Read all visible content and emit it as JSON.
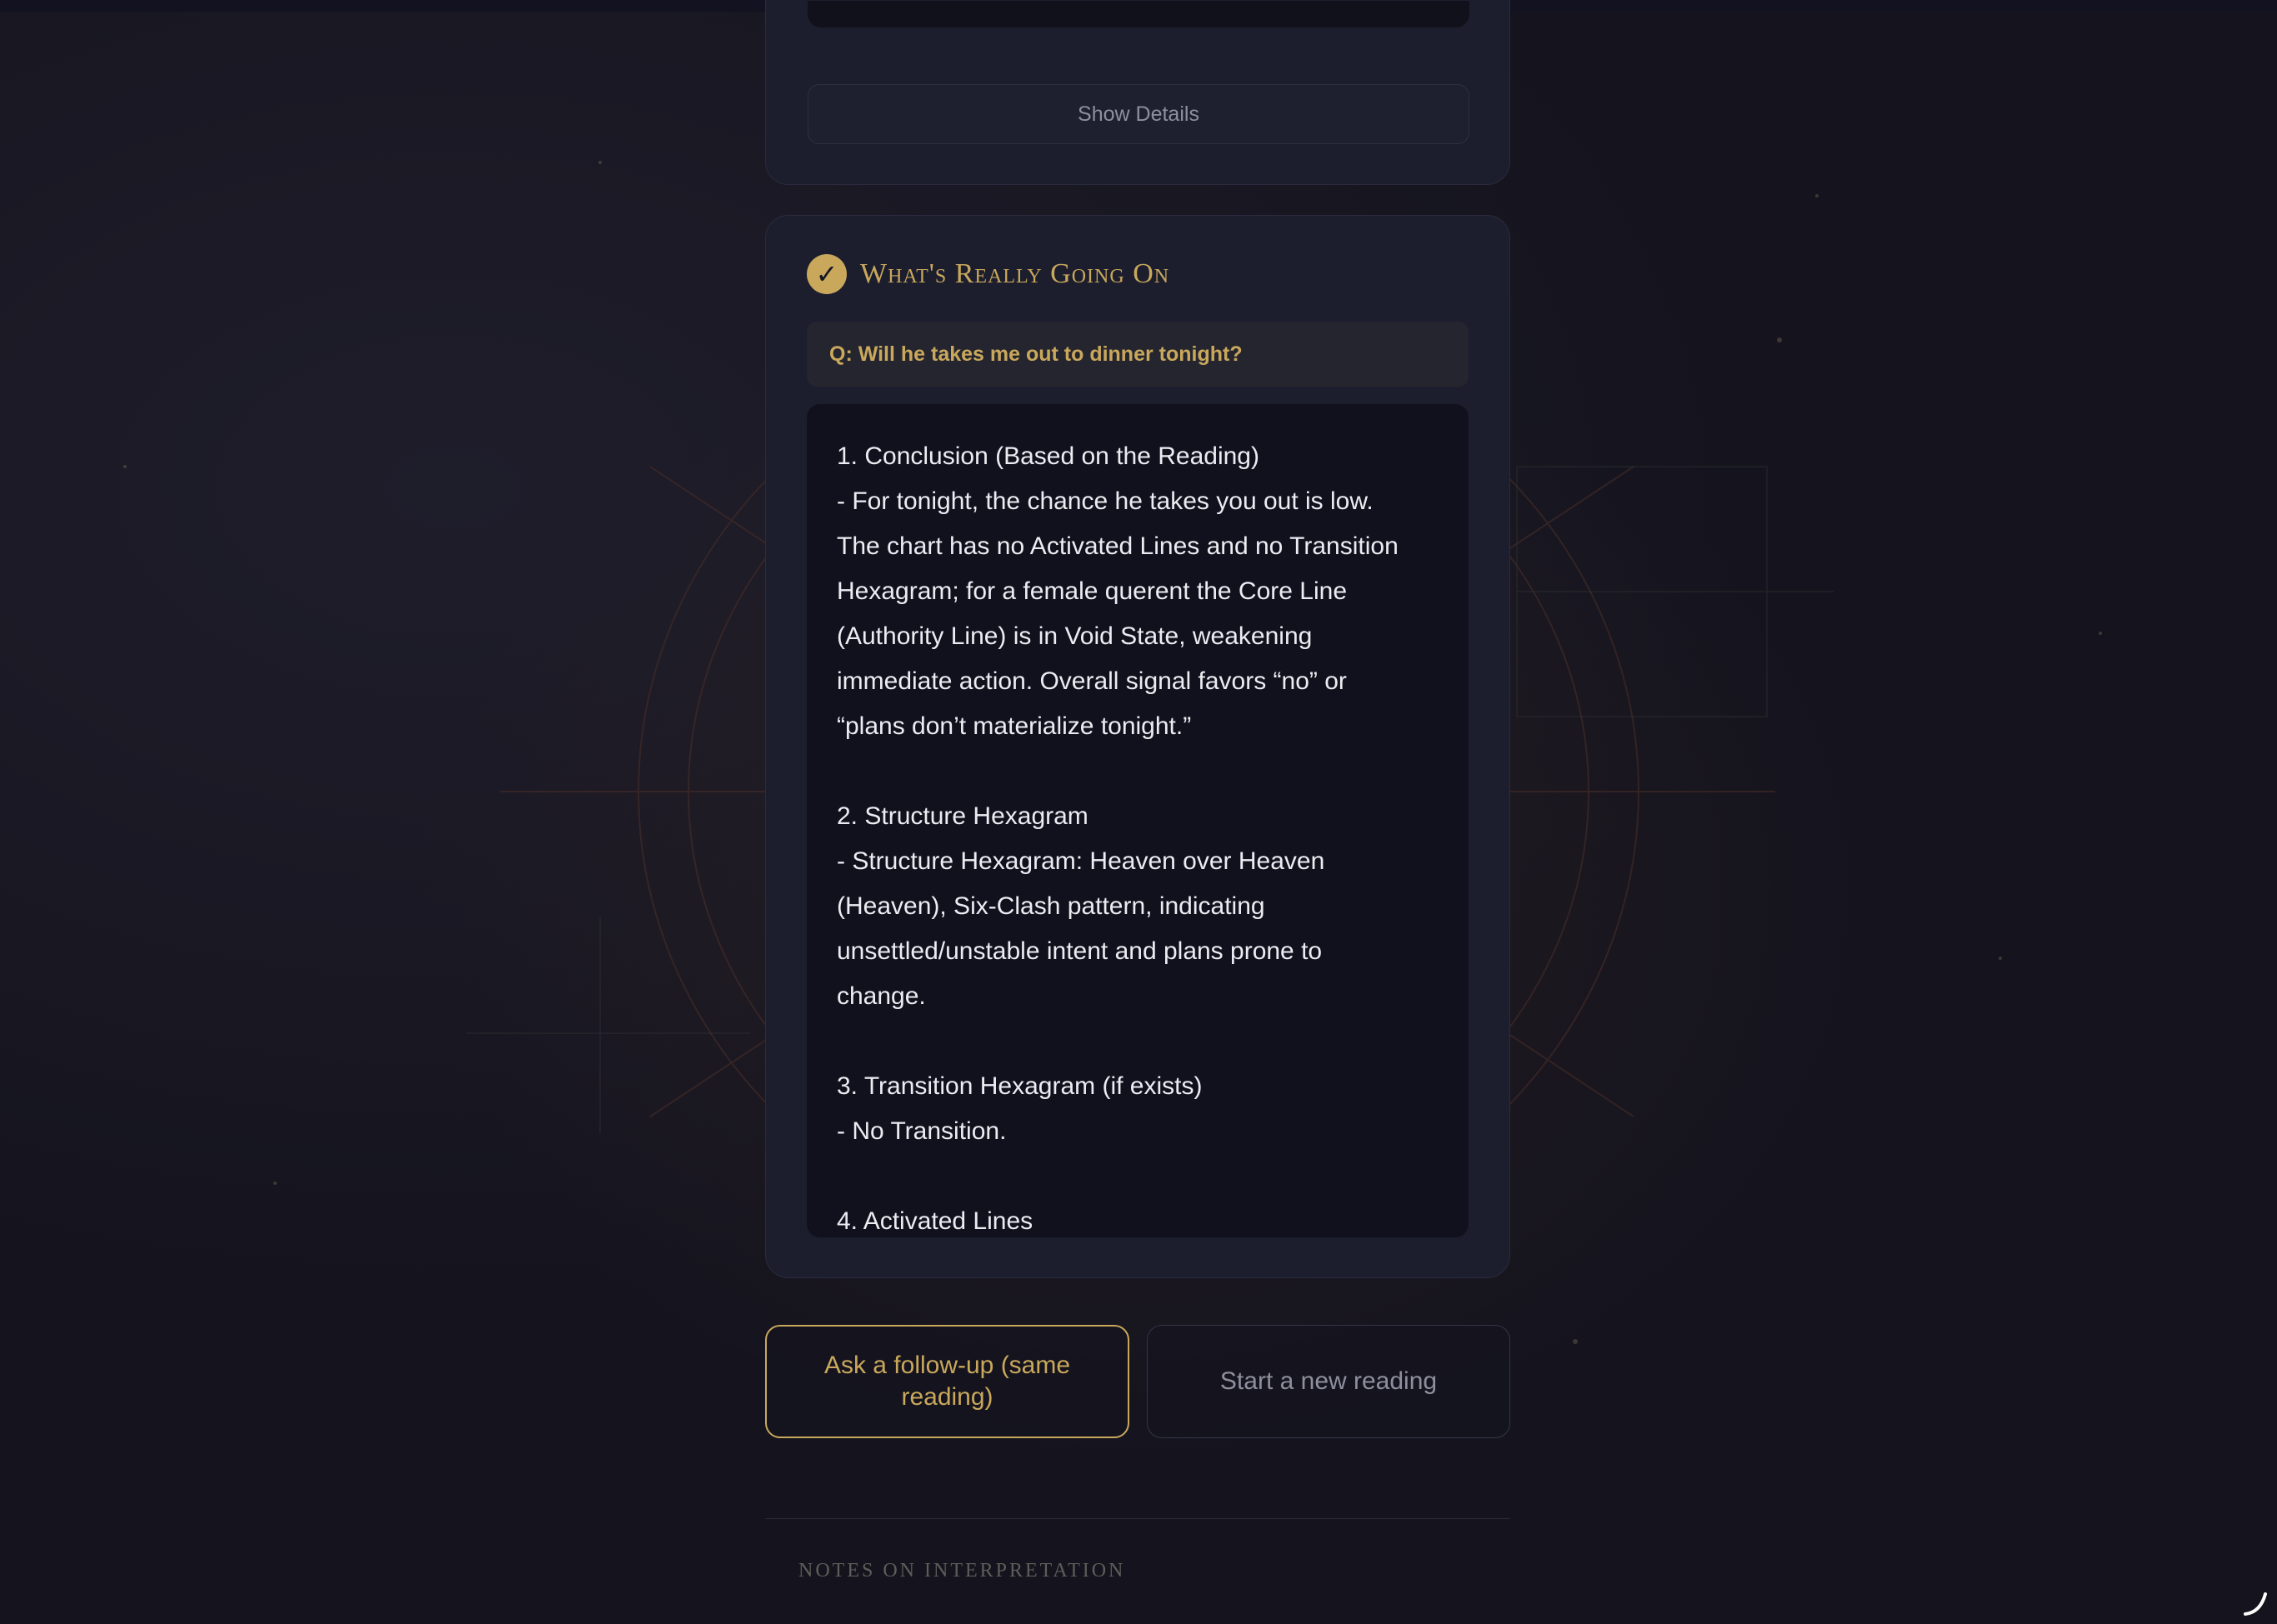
{
  "details_card": {
    "show_details_label": "Show Details"
  },
  "reading_card": {
    "title": "What's Really Going On",
    "check_icon": "✓",
    "question": "Q: Will he takes me out to dinner tonight?",
    "answer_lines": [
      "1. Conclusion (Based on the Reading)",
      "- For tonight, the chance he takes you out is low.",
      "The chart has no Activated Lines and no Transition",
      "Hexagram; for a female querent the Core Line",
      "(Authority Line) is in Void State, weakening",
      "immediate action. Overall signal favors “no” or",
      "“plans don’t materialize tonight.”",
      "",
      "2. Structure Hexagram",
      "- Structure Hexagram: Heaven over Heaven",
      "(Heaven), Six-Clash pattern, indicating",
      "unsettled/unstable intent and plans prone to",
      "change.",
      "",
      "3. Transition Hexagram (if exists)",
      "- No Transition.",
      "",
      "4. Activated Lines"
    ]
  },
  "actions": {
    "follow_up_label": "Ask a follow-up (same reading)",
    "new_reading_label": "Start a new reading"
  },
  "footer": {
    "notes_heading": "Notes on Interpretation"
  },
  "colors": {
    "accent_gold": "#c9a85c",
    "card_bg": "#1c1e2e",
    "answer_bg": "#11111d",
    "page_bg": "#15141e"
  },
  "icons": {
    "check": "check-icon",
    "corner": "loading-arc-icon"
  }
}
